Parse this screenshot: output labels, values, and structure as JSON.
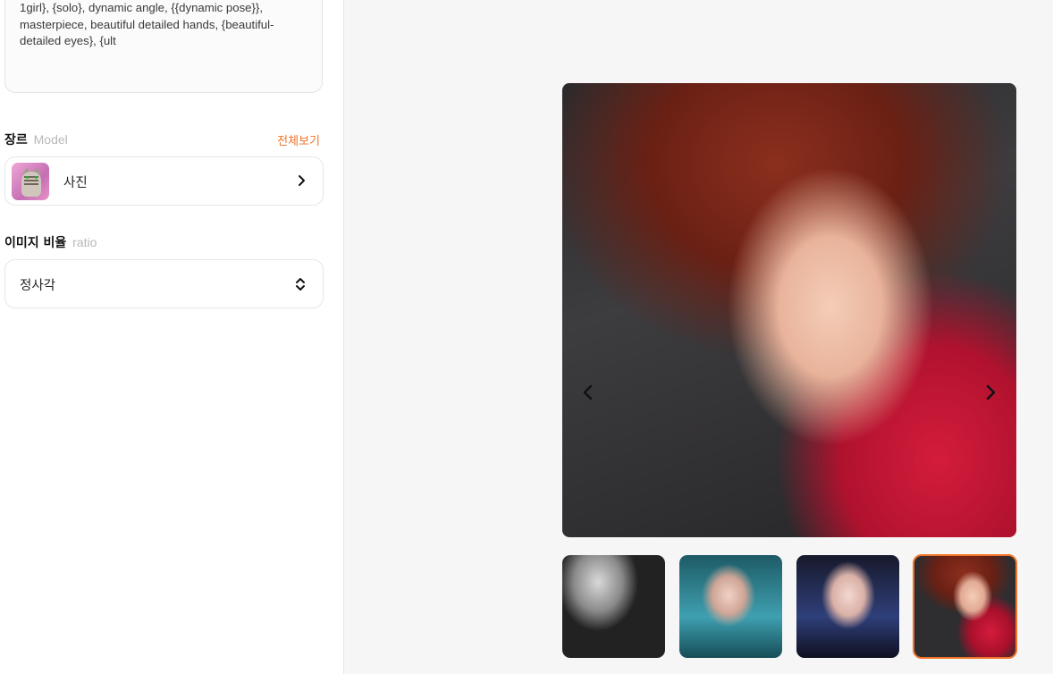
{
  "prompt": {
    "text": "1girl}, {solo}, dynamic angle, {{dynamic pose}}, masterpiece, beautiful detailed hands, {beautiful-detailed eyes}, {ult"
  },
  "model_section": {
    "title": "장르",
    "subtitle": "Model",
    "view_all": "전체보기",
    "selected": {
      "label": "사진",
      "icon": "cat-thumbnail"
    }
  },
  "ratio_section": {
    "title": "이미지 비율",
    "subtitle": "ratio",
    "selected": "정사각"
  },
  "gallery": {
    "selected_index": 3,
    "thumbnails": [
      {
        "name": "thumbnail-1"
      },
      {
        "name": "thumbnail-2"
      },
      {
        "name": "thumbnail-3"
      },
      {
        "name": "thumbnail-4"
      }
    ]
  },
  "colors": {
    "accent": "#f07427",
    "panel_bg": "#f6f6f6"
  }
}
